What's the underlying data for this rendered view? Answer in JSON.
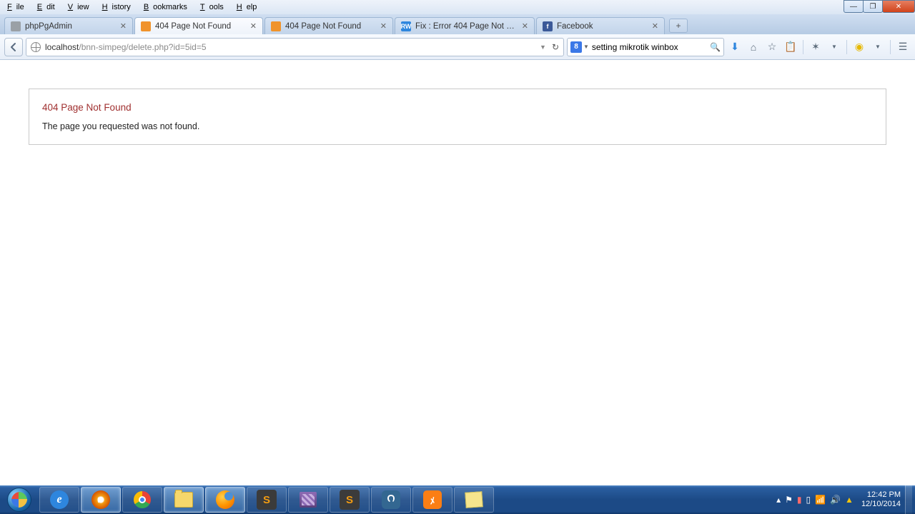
{
  "menu": {
    "file": "File",
    "edit": "Edit",
    "view": "View",
    "history": "History",
    "bookmarks": "Bookmarks",
    "tools": "Tools",
    "help": "Help"
  },
  "tabs": [
    {
      "title": "phpPgAdmin",
      "favcolor": "#9aa0a6",
      "favtext": ""
    },
    {
      "title": "404 Page Not Found",
      "favcolor": "#f0932b",
      "favtext": ""
    },
    {
      "title": "404 Page Not Found",
      "favcolor": "#f0932b",
      "favtext": ""
    },
    {
      "title": "Fix : Error 404 Page Not Fo...",
      "favcolor": "#2e86de",
      "favtext": "RW"
    },
    {
      "title": "Facebook",
      "favcolor": "#3b5998",
      "favtext": "f"
    }
  ],
  "url": {
    "host": "localhost",
    "path": "/bnn-simpeg/delete.php?id=5id=5"
  },
  "search": {
    "value": "setting mikrotik winbox"
  },
  "error": {
    "title": "404 Page Not Found",
    "msg": "The page you requested was not found."
  },
  "tray": {
    "time": "12:42 PM",
    "date": "12/10/2014"
  },
  "taskapps": [
    {
      "name": "ie",
      "bg": "#2e86de",
      "glyph": "e",
      "active": false
    },
    {
      "name": "wmp",
      "bg": "#f39c12",
      "glyph": "▶",
      "active": true
    },
    {
      "name": "chrome",
      "bg": "",
      "glyph": "",
      "active": false
    },
    {
      "name": "explorer",
      "bg": "#f6d76b",
      "glyph": "",
      "active": true
    },
    {
      "name": "firefox",
      "bg": "#e67e22",
      "glyph": "",
      "active": true
    },
    {
      "name": "sublime1",
      "bg": "#3b3b3b",
      "glyph": "S",
      "active": false
    },
    {
      "name": "winrar",
      "bg": "#6b4f8a",
      "glyph": "",
      "active": false
    },
    {
      "name": "sublime2",
      "bg": "#3b3b3b",
      "glyph": "S",
      "active": false
    },
    {
      "name": "pg",
      "bg": "#336791",
      "glyph": "",
      "active": false
    },
    {
      "name": "xampp",
      "bg": "#fb7e14",
      "glyph": "",
      "active": false
    },
    {
      "name": "notes",
      "bg": "#f6e58d",
      "glyph": "",
      "active": false
    }
  ]
}
